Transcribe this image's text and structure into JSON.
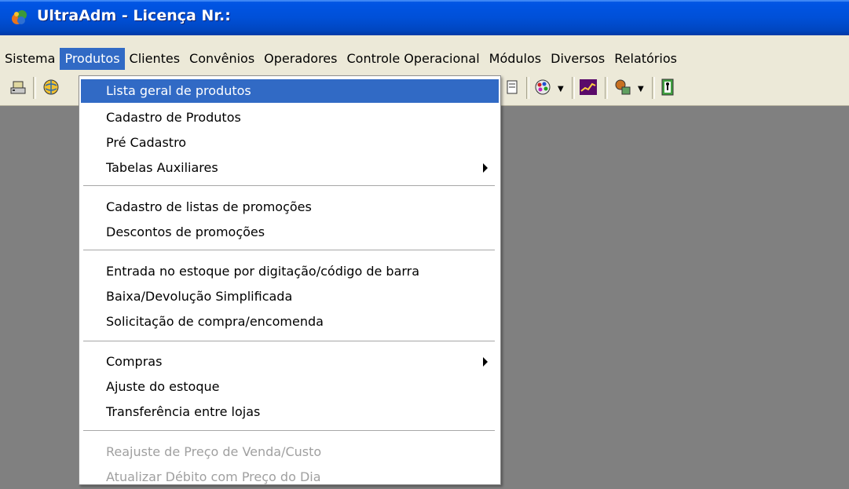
{
  "window": {
    "title": "UltraAdm - Licença Nr.:"
  },
  "menubar": {
    "items": [
      {
        "label": "Sistema"
      },
      {
        "label": "Produtos"
      },
      {
        "label": "Clientes"
      },
      {
        "label": "Convênios"
      },
      {
        "label": "Operadores"
      },
      {
        "label": "Controle Operacional"
      },
      {
        "label": "Módulos"
      },
      {
        "label": "Diversos"
      },
      {
        "label": "Relatórios"
      }
    ],
    "active": "Produtos"
  },
  "produtos_menu": {
    "items": [
      {
        "label": "Lista geral de produtos",
        "state": "selected"
      },
      {
        "label": "Cadastro de Produtos"
      },
      {
        "label": "Pré Cadastro"
      },
      {
        "label": "Tabelas Auxiliares",
        "submenu": true
      },
      {
        "label": "Cadastro de listas de promoções"
      },
      {
        "label": "Descontos de promoções"
      },
      {
        "label": "Entrada no estoque por digitação/código de barra"
      },
      {
        "label": "Baixa/Devolução Simplificada"
      },
      {
        "label": "Solicitação de compra/encomenda"
      },
      {
        "label": "Compras",
        "submenu": true
      },
      {
        "label": "Ajuste do estoque"
      },
      {
        "label": "Transferência entre lojas"
      },
      {
        "label": "Reajuste de Preço de Venda/Custo",
        "state": "disabled"
      },
      {
        "label": "Atualizar Débito com Preço do Dia",
        "state": "disabled"
      }
    ]
  },
  "toolbar": {
    "icons": [
      "scanner-icon",
      "globe-icon",
      "file-icon",
      "color-palette-icon",
      "chart-icon",
      "network-icon",
      "exit-icon"
    ]
  },
  "colors": {
    "titlebar": "#0054e3",
    "menu_highlight": "#316ac5",
    "workspace": "#808080",
    "chrome": "#ece9d8"
  }
}
